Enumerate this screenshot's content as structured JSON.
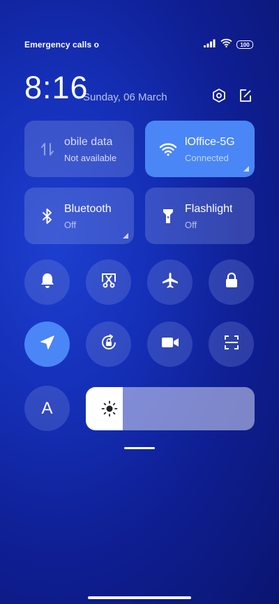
{
  "status_bar": {
    "carrier": "Emergency calls o",
    "battery": "100"
  },
  "header": {
    "time": "8:16",
    "date": "Sunday, 06 March"
  },
  "tiles": {
    "mobile_data": {
      "label": "obile data",
      "status": "Not available"
    },
    "wifi": {
      "label": "lOffice-5G",
      "status": "Connected"
    },
    "bluetooth": {
      "label": "Bluetooth",
      "status": "Off"
    },
    "flashlight": {
      "label": "Flashlight",
      "status": "Off"
    }
  },
  "toggles_row1": [
    "bell-icon",
    "screenshot-icon",
    "airplane-icon",
    "lock-icon"
  ],
  "toggles_row2": [
    "location-icon",
    "rotation-lock-icon",
    "video-icon",
    "scan-icon"
  ],
  "reading_mode": {
    "glyph": "A"
  },
  "brightness": {
    "level": 0.22
  },
  "colors": {
    "accent": "#4a86f5",
    "tile_dim": "rgba(150,170,235,0.28)"
  }
}
